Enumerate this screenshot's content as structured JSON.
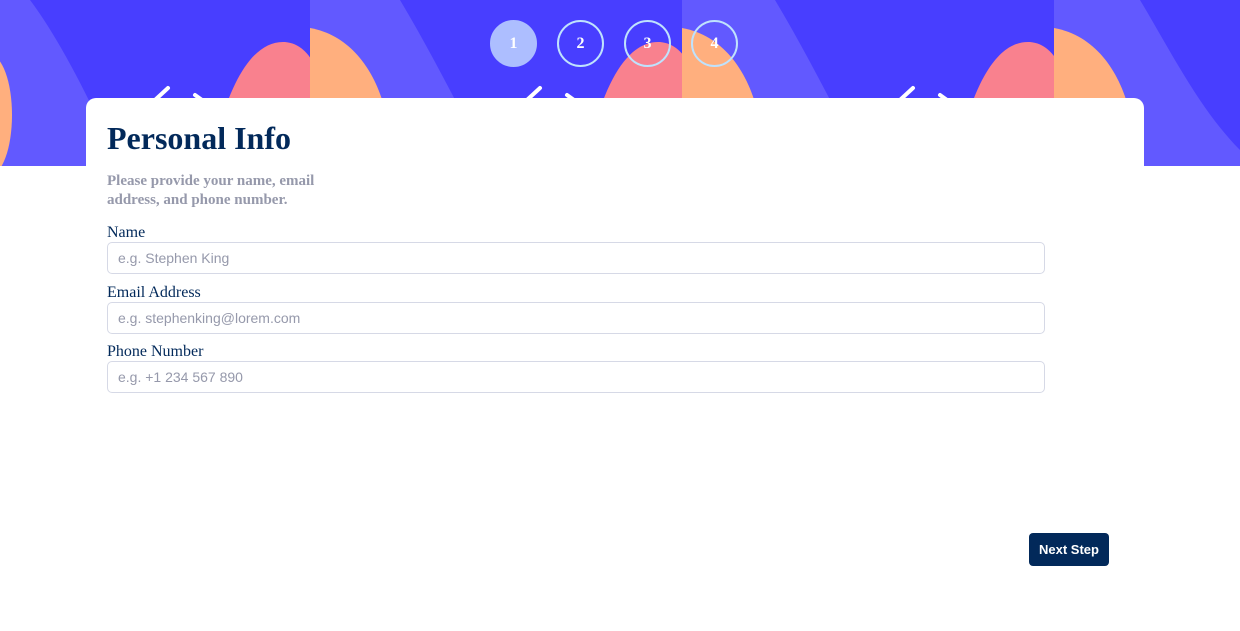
{
  "colors": {
    "banner_primary": "#483eff",
    "banner_secondary": "#6259ff",
    "shape_pink": "#f9818e",
    "shape_orange": "#ffaf7e",
    "step_active": "#adbeff",
    "heading": "#02295a",
    "muted": "#9699ab",
    "button_bg": "#02295a"
  },
  "steps": [
    {
      "number": "1",
      "active": true
    },
    {
      "number": "2",
      "active": false
    },
    {
      "number": "3",
      "active": false
    },
    {
      "number": "4",
      "active": false
    }
  ],
  "form": {
    "title": "Personal Info",
    "subtitle": "Please provide your name, email address, and phone number.",
    "fields": [
      {
        "label": "Name",
        "placeholder": "e.g. Stephen King",
        "value": ""
      },
      {
        "label": "Email Address",
        "placeholder": "e.g. stephenking@lorem.com",
        "value": ""
      },
      {
        "label": "Phone Number",
        "placeholder": "e.g. +1 234 567 890",
        "value": ""
      }
    ],
    "next_label": "Next Step"
  }
}
